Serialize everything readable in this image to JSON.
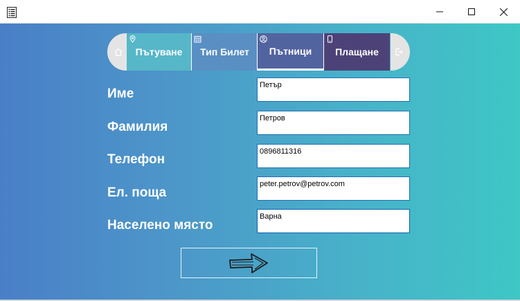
{
  "window": {
    "icons": {
      "app": "list-icon",
      "minimize": "minimize-icon",
      "maximize": "maximize-icon",
      "close": "close-icon"
    }
  },
  "nav": {
    "home_icon": "home-icon",
    "exit_icon": "exit-icon",
    "tabs": [
      {
        "label": "Пътуване",
        "icon": "location-pin-icon"
      },
      {
        "label": "Тип Билет",
        "icon": "calendar-icon"
      },
      {
        "label": "Пътници",
        "icon": "user-circle-icon",
        "selected": true
      },
      {
        "label": "Плащане",
        "icon": "phone-icon"
      }
    ],
    "colors": {
      "trip": "#56b7c8",
      "ticket": "#5a8fc4",
      "passengers": "#52649f",
      "payment": "#4d4278"
    }
  },
  "form": {
    "first_name": {
      "label": "Име",
      "value": "Петър"
    },
    "last_name": {
      "label": "Фамилия",
      "value": "Петров"
    },
    "phone": {
      "label": "Телефон",
      "value": "0896811316"
    },
    "email": {
      "label": "Ел. поща",
      "value": "peter.petrov@petrov.com"
    },
    "city": {
      "label": "Населено място",
      "value": "Варна"
    }
  },
  "next_button": {
    "icon": "arrow-right-icon"
  }
}
